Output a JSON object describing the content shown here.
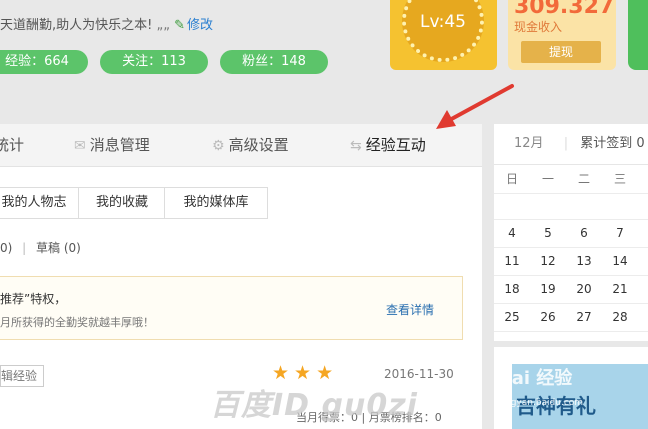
{
  "profile": {
    "motto": "天道酬勤,助人为快乐之本!",
    "quote_mark": "„„",
    "edit_label": "修改",
    "stats": [
      {
        "label": "经验：664"
      },
      {
        "label": "关注：113"
      },
      {
        "label": "粉丝：148"
      }
    ]
  },
  "level_card": {
    "label": "Lv:45"
  },
  "cash_card": {
    "value": "309.327",
    "label": "现金收入",
    "withdraw": "提现"
  },
  "tabs": [
    {
      "label": "统计",
      "icon": ""
    },
    {
      "label": "消息管理",
      "icon": "envelope-icon"
    },
    {
      "label": "高级设置",
      "icon": "gear-icon"
    },
    {
      "label": "经验互动",
      "icon": "swap-arrows-icon"
    }
  ],
  "subtabs": [
    {
      "label": "我的人物志"
    },
    {
      "label": "我的收藏"
    },
    {
      "label": "我的媒体库"
    }
  ],
  "counts": {
    "published": "0)",
    "sep": "|",
    "drafts": "草稿 (0)"
  },
  "notice": {
    "line1": "推荐”特权，",
    "line2": "月所获得的全勤奖就越丰厚哦！",
    "details": "查看详情"
  },
  "entry": {
    "tag": "辑经验",
    "rating": 3,
    "stars": "★★★",
    "date": "2016-11-30",
    "stats": "当月得票：0 | 月票榜排名：0"
  },
  "calendar": {
    "month": "12月",
    "signin": "累计签到 0",
    "weekdays": [
      "日",
      "一",
      "二",
      "三"
    ],
    "rows": [
      [
        "4",
        "5",
        "6",
        "7"
      ],
      [
        "11",
        "12",
        "13",
        "14"
      ],
      [
        "18",
        "19",
        "20",
        "21"
      ],
      [
        "25",
        "26",
        "27",
        "28"
      ]
    ]
  },
  "promo": {
    "text": "吉神有礼"
  },
  "watermark": {
    "main": "百度ID gu0zi",
    "brand": "Bai 经验",
    "url": "jingyan.baidu.com"
  },
  "colors": {
    "accent_green": "#5cc46a",
    "arrow_red": "#e03a30",
    "cash_orange": "#f26a3a"
  }
}
